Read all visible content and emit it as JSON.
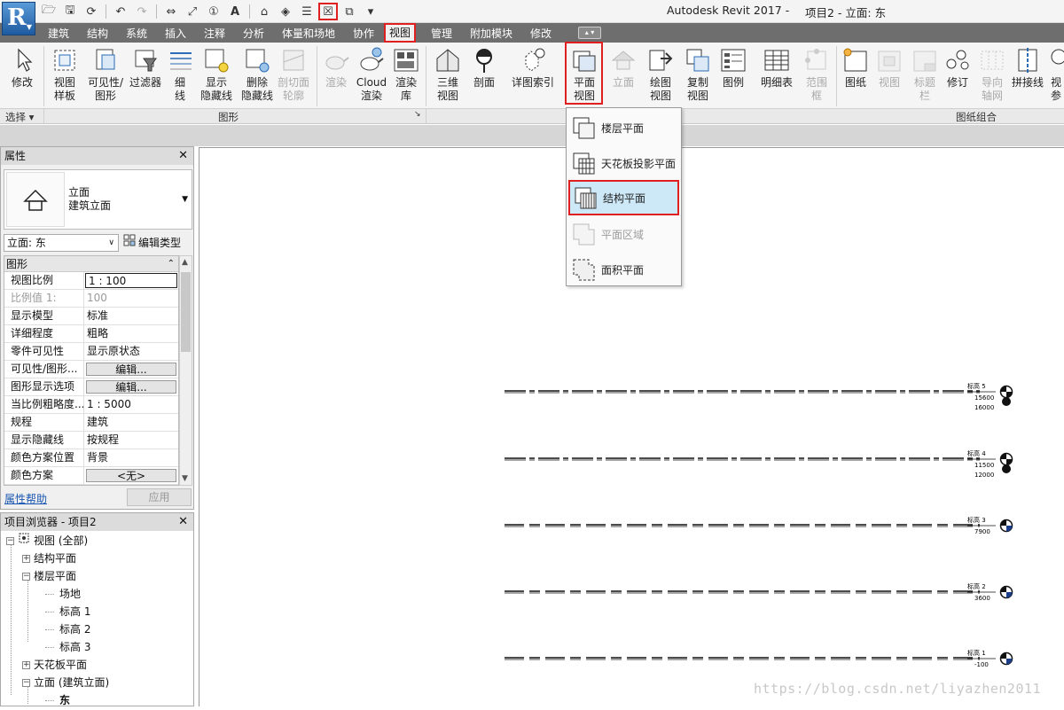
{
  "window": {
    "title": "Autodesk Revit 2017 -",
    "document": "项目2 - 立面: 东"
  },
  "app_button": {
    "letter": "R"
  },
  "quick_access": [
    "open-icon",
    "save-icon",
    "sync-icon",
    "undo-icon",
    "redo-icon",
    "measure-icon",
    "dimension-icon",
    "tag-icon",
    "text-icon",
    "3d-view-icon",
    "section-icon",
    "thin-lines-icon",
    "close-windows-icon",
    "switch-windows-icon",
    "customize-icon"
  ],
  "tabs": [
    "建筑",
    "结构",
    "系统",
    "插入",
    "注释",
    "分析",
    "体量和场地",
    "协作",
    "视图",
    "管理",
    "附加模块",
    "修改"
  ],
  "active_tab": "视图",
  "ribbon": {
    "modify": {
      "label": "修改"
    },
    "select_panel": "选择 ▾",
    "graphics": {
      "items": [
        {
          "label": "视图\n样板",
          "dim": false
        },
        {
          "label": "可见性/\n图形",
          "dim": false
        },
        {
          "label": "过滤器",
          "dim": false
        },
        {
          "label": "细\n线",
          "dim": false
        },
        {
          "label": "显示\n隐藏线",
          "dim": false
        },
        {
          "label": "删除\n隐藏线",
          "dim": false
        },
        {
          "label": "剖切面\n轮廓",
          "dim": true
        },
        {
          "label": "渲染",
          "dim": true
        },
        {
          "label": "Cloud\n渲染",
          "dim": false
        },
        {
          "label": "渲染\n库",
          "dim": false
        }
      ],
      "panel_label": "图形"
    },
    "create": {
      "items": [
        {
          "label": "三维\n视图",
          "dim": false
        },
        {
          "label": "剖面",
          "dim": false
        },
        {
          "label": "详图索引",
          "dim": false
        },
        {
          "label": "平面\n视图",
          "dim": false
        },
        {
          "label": "立面",
          "dim": true
        },
        {
          "label": "绘图\n视图",
          "dim": false
        },
        {
          "label": "复制\n视图",
          "dim": false
        },
        {
          "label": "图例",
          "dim": false
        },
        {
          "label": "明细表",
          "dim": false
        },
        {
          "label": "范围\n框",
          "dim": true
        }
      ]
    },
    "sheet": {
      "items": [
        {
          "label": "图纸",
          "dim": false
        },
        {
          "label": "视图",
          "dim": true
        },
        {
          "label": "标题\n栏",
          "dim": true
        },
        {
          "label": "修订",
          "dim": false
        },
        {
          "label": "导向\n轴网",
          "dim": true
        },
        {
          "label": "拼接线",
          "dim": false
        },
        {
          "label": "视\n参",
          "dim": false
        }
      ],
      "panel_label": "图纸组合"
    }
  },
  "plan_view_menu": {
    "items": [
      {
        "label": "楼层平面",
        "dim": false,
        "selected": false
      },
      {
        "label": "天花板投影平面",
        "dim": false,
        "selected": false
      },
      {
        "label": "结构平面",
        "dim": false,
        "selected": true
      },
      {
        "label": "平面区域",
        "dim": true,
        "selected": false
      },
      {
        "label": "面积平面",
        "dim": false,
        "selected": false
      }
    ]
  },
  "properties": {
    "title": "属性",
    "type_line1": "立面",
    "type_line2": "建筑立面",
    "instance_select": "立面: 东",
    "edit_type": "编辑类型",
    "group": "图形",
    "rows": [
      {
        "key": "视图比例",
        "value": "1 : 100",
        "kind": "input",
        "dim": false
      },
      {
        "key": "比例值 1:",
        "value": "100",
        "kind": "text",
        "dim": true
      },
      {
        "key": "显示模型",
        "value": "标准",
        "kind": "text",
        "dim": false
      },
      {
        "key": "详细程度",
        "value": "粗略",
        "kind": "text",
        "dim": false
      },
      {
        "key": "零件可见性",
        "value": "显示原状态",
        "kind": "text",
        "dim": false
      },
      {
        "key": "可见性/图形...",
        "value": "编辑...",
        "kind": "button",
        "dim": false
      },
      {
        "key": "图形显示选项",
        "value": "编辑...",
        "kind": "button",
        "dim": false
      },
      {
        "key": "当比例粗略度...",
        "value": "1 : 5000",
        "kind": "text",
        "dim": false
      },
      {
        "key": "规程",
        "value": "建筑",
        "kind": "text",
        "dim": false
      },
      {
        "key": "显示隐藏线",
        "value": "按规程",
        "kind": "text",
        "dim": false
      },
      {
        "key": "颜色方案位置",
        "value": "背景",
        "kind": "text",
        "dim": false
      },
      {
        "key": "颜色方案",
        "value": "<无>",
        "kind": "button",
        "dim": false
      }
    ],
    "help": "属性帮助",
    "apply": "应用"
  },
  "browser": {
    "title": "项目浏览器 - 项目2",
    "tree": [
      {
        "label": "视图 (全部)",
        "level": 0,
        "toggle": "−",
        "icon": true
      },
      {
        "label": "结构平面",
        "level": 1,
        "toggle": "+"
      },
      {
        "label": "楼层平面",
        "level": 1,
        "toggle": "−"
      },
      {
        "label": "场地",
        "level": 2,
        "toggle": ""
      },
      {
        "label": "标高 1",
        "level": 2,
        "toggle": ""
      },
      {
        "label": "标高 2",
        "level": 2,
        "toggle": ""
      },
      {
        "label": "标高 3",
        "level": 2,
        "toggle": ""
      },
      {
        "label": "天花板平面",
        "level": 1,
        "toggle": "+"
      },
      {
        "label": "立面 (建筑立面)",
        "level": 1,
        "toggle": "−"
      },
      {
        "label": "东",
        "level": 2,
        "toggle": "",
        "bold": true
      }
    ]
  },
  "levels": [
    {
      "name": "标高 5",
      "elev": "15600",
      "elev2": "16000"
    },
    {
      "name": "标高 4",
      "elev": "11500",
      "elev2": "12000"
    },
    {
      "name": "标高 3",
      "elev": "7900",
      "elev2": ""
    },
    {
      "name": "标高 2",
      "elev": "3600",
      "elev2": ""
    },
    {
      "name": "标高 1",
      "elev": "-100",
      "elev2": ""
    }
  ],
  "watermark": "https://blog.csdn.net/liyazhen2011"
}
